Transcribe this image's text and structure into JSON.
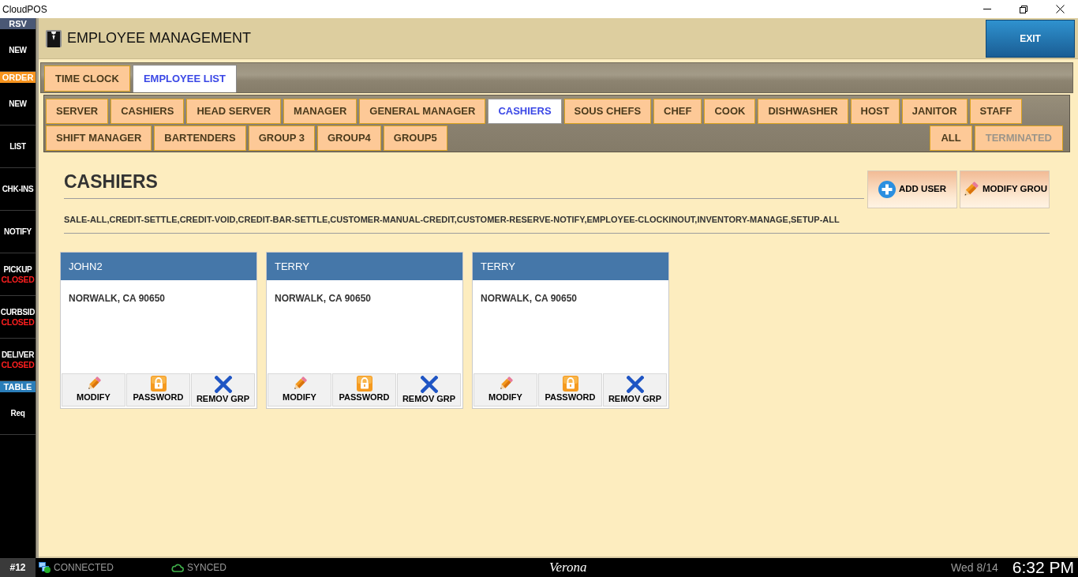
{
  "window": {
    "title": "CloudPOS"
  },
  "sidebar": {
    "sections": [
      {
        "header": "RSV",
        "color": "#4a5875",
        "items": [
          {
            "label": "NEW"
          }
        ]
      },
      {
        "header": "ORDER",
        "color": "#f7941e",
        "items": [
          {
            "label": "NEW"
          },
          {
            "label": "LIST"
          },
          {
            "label": "CHK-INS"
          },
          {
            "label": "NOTIFY"
          },
          {
            "label": "PICKUP",
            "status": "CLOSED"
          },
          {
            "label": "CURBSID",
            "status": "CLOSED"
          },
          {
            "label": "DELIVER",
            "status": "CLOSED"
          }
        ]
      },
      {
        "header": "TABLE",
        "color": "#2a7db8",
        "items": [
          {
            "label": "Req"
          }
        ]
      }
    ]
  },
  "header": {
    "title": "EMPLOYEE MANAGEMENT",
    "exit_button": "EXIT"
  },
  "main_tabs": [
    {
      "label": "TIME CLOCK",
      "selected": false
    },
    {
      "label": "EMPLOYEE LIST",
      "selected": true
    }
  ],
  "group_tab_rows": [
    {
      "tabs": [
        {
          "label": "SERVER",
          "selected": false
        },
        {
          "label": "CASHIERS",
          "selected": false
        },
        {
          "label": "HEAD SERVER",
          "selected": false
        },
        {
          "label": "MANAGER",
          "selected": false
        },
        {
          "label": "GENERAL MANAGER",
          "selected": false
        },
        {
          "label": "CASHIERS",
          "selected": true
        },
        {
          "label": "SOUS CHEFS",
          "selected": false
        },
        {
          "label": "CHEF",
          "selected": false
        },
        {
          "label": "COOK",
          "selected": false
        },
        {
          "label": "DISHWASHER",
          "selected": false
        },
        {
          "label": "HOST",
          "selected": false
        },
        {
          "label": "JANITOR",
          "selected": false
        },
        {
          "label": "STAFF",
          "selected": false
        }
      ]
    },
    {
      "tabs": [
        {
          "label": "SHIFT MANAGER",
          "selected": false
        },
        {
          "label": "BARTENDERS",
          "selected": false
        },
        {
          "label": "GROUP 3",
          "selected": false
        },
        {
          "label": "GROUP4",
          "selected": false
        },
        {
          "label": "GROUP5",
          "selected": false
        }
      ]
    }
  ],
  "filter_tabs": [
    {
      "label": "ALL",
      "disabled": false
    },
    {
      "label": "TERMINATED",
      "disabled": true
    }
  ],
  "group": {
    "title": "CASHIERS",
    "permissions": "SALE-ALL,CREDIT-SETTLE,CREDIT-VOID,CREDIT-BAR-SETTLE,CUSTOMER-MANUAL-CREDIT,CUSTOMER-RESERVE-NOTIFY,EMPLOYEE-CLOCKINOUT,INVENTORY-MANAGE,SETUP-ALL",
    "actions": [
      {
        "kind": "add",
        "label": "ADD USER"
      },
      {
        "kind": "modify",
        "label": "MODIFY GROU"
      }
    ]
  },
  "cards": [
    {
      "name": "JOHN2",
      "address": "NORWALK, CA 90650",
      "actions": [
        {
          "kind": "modify",
          "label": "MODIFY"
        },
        {
          "kind": "password",
          "label": "PASSWORD"
        },
        {
          "kind": "remove",
          "label": "REMOV GRP"
        }
      ]
    },
    {
      "name": "TERRY",
      "address": "NORWALK, CA 90650",
      "actions": [
        {
          "kind": "modify",
          "label": "MODIFY"
        },
        {
          "kind": "password",
          "label": "PASSWORD"
        },
        {
          "kind": "remove",
          "label": "REMOV GRP"
        }
      ]
    },
    {
      "name": "TERRY",
      "address": "NORWALK, CA 90650",
      "actions": [
        {
          "kind": "modify",
          "label": "MODIFY"
        },
        {
          "kind": "password",
          "label": "PASSWORD"
        },
        {
          "kind": "remove",
          "label": "REMOV GRP"
        }
      ]
    }
  ],
  "status_bar": {
    "station": "#12",
    "connection": "CONNECTED",
    "sync": "SYNCED",
    "location": "Verona",
    "date": "Wed 8/14",
    "time": "6:32 PM"
  }
}
